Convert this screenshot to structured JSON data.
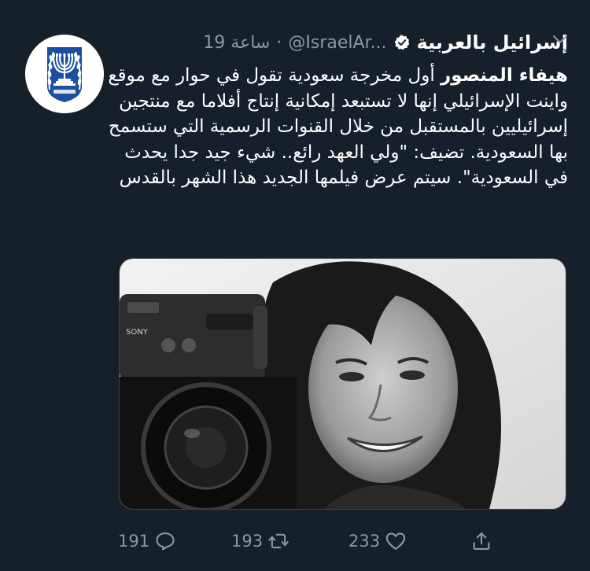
{
  "tweet": {
    "display_name": "إسرائيل بالعربية",
    "handle": "@IsraelAr...",
    "separator": "·",
    "time": "19 ساعة",
    "text_bold": "هيفاء المنصور",
    "text_body": " أول مخرجة سعودية تقول في حوار مع موقع واينت الإسرائيلي إنها لا تستبعد إمكانية إنتاج أفلاما مع منتجين إسرائيليين بالمستقبل من خلال القنوات الرسمية التي ستسمح بها السعودية. تضيف: \"ولي العهد رائع.. شيء جيد جدا يحدث في السعودية\". سيتم عرض فيلمها الجديد هذا الشهر بالقدس"
  },
  "actions": {
    "reply_count": "191",
    "retweet_count": "193",
    "like_count": "233"
  },
  "icons": {
    "verified": "verified-badge-icon",
    "caret": "chevron-down-icon",
    "reply": "reply-icon",
    "retweet": "retweet-icon",
    "like": "heart-icon",
    "share": "share-icon"
  },
  "colors": {
    "background": "#15202b",
    "secondary_text": "#8899a6",
    "primary_text": "#ffffff",
    "emblem_blue": "#1b4fa0"
  }
}
